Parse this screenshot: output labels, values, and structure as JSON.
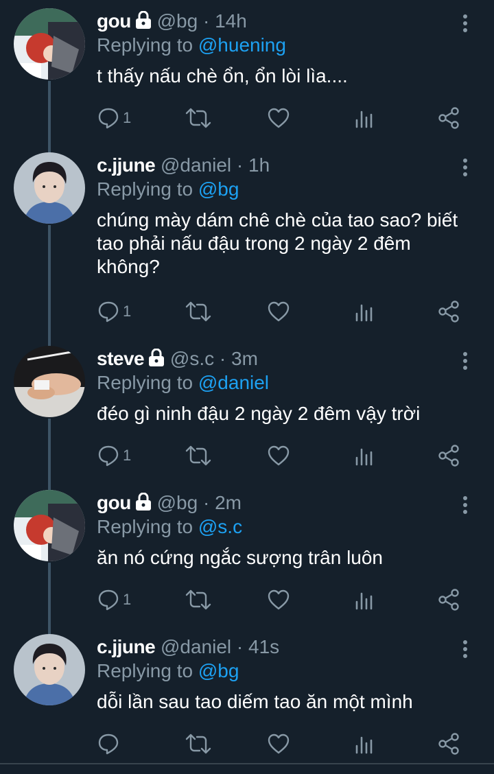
{
  "reply_prefix": "Replying to ",
  "tweets": [
    {
      "name": "gou",
      "locked": true,
      "handle": "@bg",
      "dot": "·",
      "time": "14h",
      "reply_to": "@huening",
      "text": "t thấy nấu chè ổn, ổn lòi lìa....",
      "reply_count": "1",
      "avatar": "red-hair-art"
    },
    {
      "name": "c.jjune",
      "locked": false,
      "handle": "@daniel",
      "dot": "·",
      "time": "1h",
      "reply_to": "@bg",
      "text": "chúng mày dám chê chè của tao sao? biết tao phải nấu đậu trong 2 ngày 2 đêm không?",
      "reply_count": "1",
      "avatar": "person-photo"
    },
    {
      "name": "steve",
      "locked": true,
      "handle": "@s.c",
      "dot": "·",
      "time": "3m",
      "reply_to": "@daniel",
      "text": "đéo gì ninh đậu 2 ngày 2 đêm vậy trời",
      "reply_count": "1",
      "avatar": "hands-photo"
    },
    {
      "name": "gou",
      "locked": true,
      "handle": "@bg",
      "dot": "·",
      "time": "2m",
      "reply_to": "@s.c",
      "text": "ăn nó cứng ngắc sượng trân luôn",
      "reply_count": "1",
      "avatar": "red-hair-art"
    },
    {
      "name": "c.jjune",
      "locked": false,
      "handle": "@daniel",
      "dot": "·",
      "time": "41s",
      "reply_to": "@bg",
      "text": "dỗi lần sau tao diếm tao ăn một mình",
      "reply_count": "",
      "avatar": "person-photo"
    }
  ],
  "colors": {
    "background": "#15202b",
    "secondary_text": "#8899a6",
    "link": "#1da1f2",
    "thread_line": "#3d5466"
  }
}
